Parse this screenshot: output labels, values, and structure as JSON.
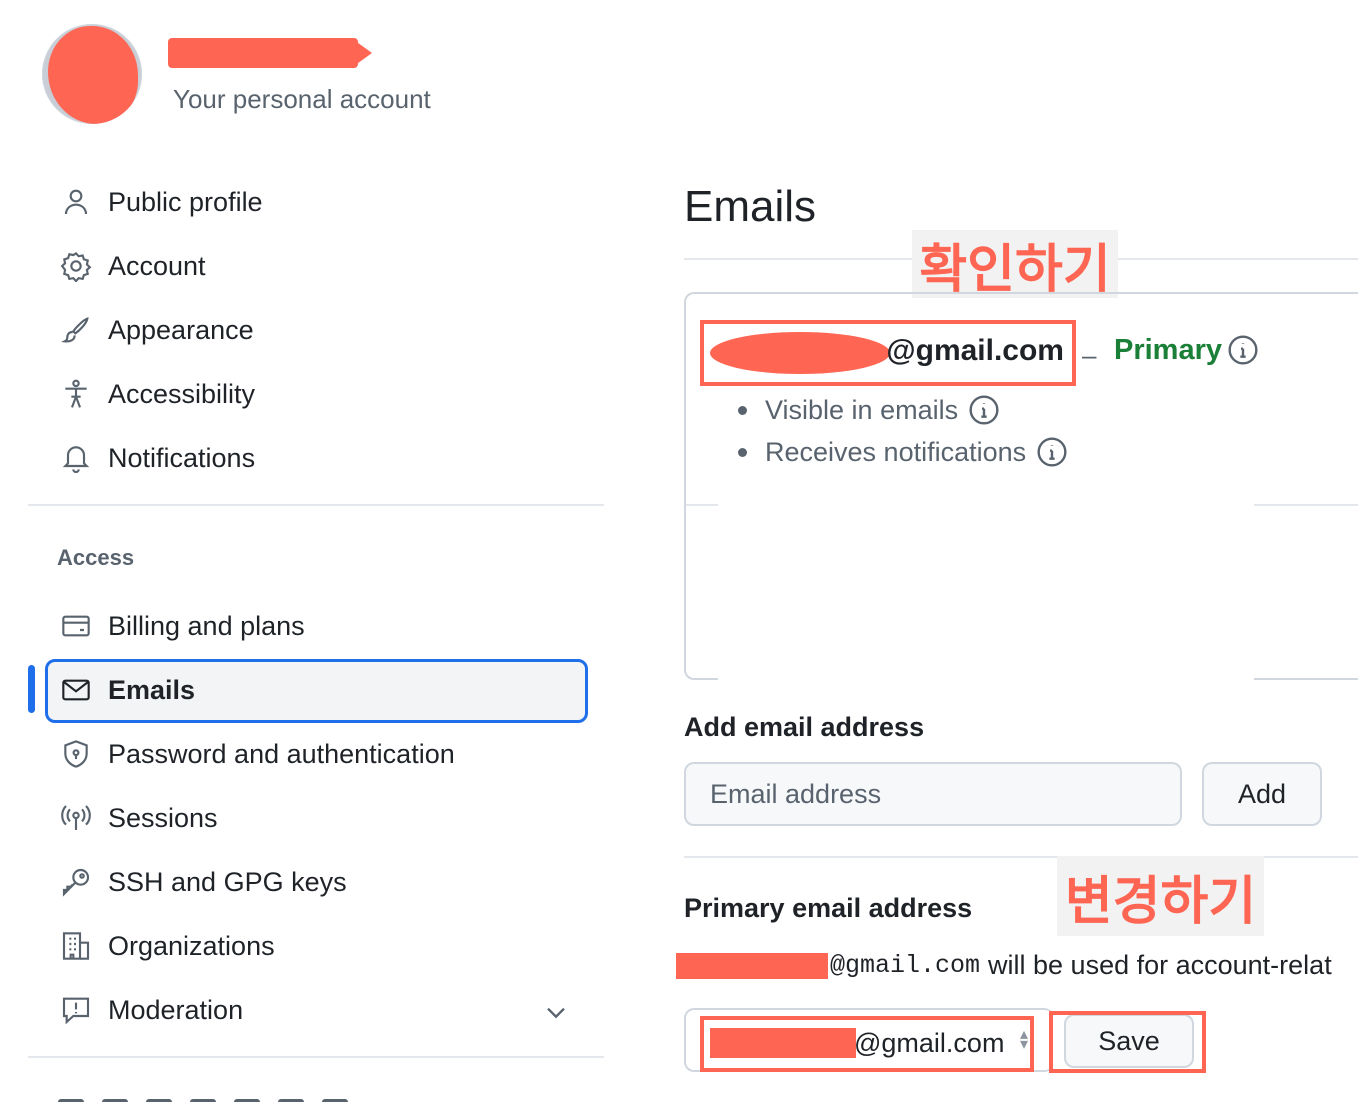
{
  "header": {
    "subtitle": "Your personal account"
  },
  "sidebar": {
    "items": [
      {
        "label": "Public profile",
        "icon": "person-icon"
      },
      {
        "label": "Account",
        "icon": "gear-icon"
      },
      {
        "label": "Appearance",
        "icon": "paintbrush-icon"
      },
      {
        "label": "Accessibility",
        "icon": "accessibility-icon"
      },
      {
        "label": "Notifications",
        "icon": "bell-icon"
      }
    ],
    "access_heading": "Access",
    "access_items": [
      {
        "label": "Billing and plans",
        "icon": "credit-card-icon"
      },
      {
        "label": "Emails",
        "icon": "mail-icon",
        "active": true
      },
      {
        "label": "Password and authentication",
        "icon": "shield-lock-icon"
      },
      {
        "label": "Sessions",
        "icon": "broadcast-icon"
      },
      {
        "label": "SSH and GPG keys",
        "icon": "key-icon"
      },
      {
        "label": "Organizations",
        "icon": "organization-icon"
      },
      {
        "label": "Moderation",
        "icon": "report-icon"
      }
    ]
  },
  "main": {
    "title": "Emails",
    "annotation_check": "확인하기",
    "annotation_change": "변경하기",
    "primary_email": {
      "address_suffix": "@gmail.com",
      "separator": "–",
      "badge": "Primary",
      "bullets": [
        "Visible in emails",
        "Receives notifications"
      ]
    },
    "add_email": {
      "heading": "Add email address",
      "placeholder": "Email address",
      "button": "Add"
    },
    "primary_section": {
      "heading": "Primary email address",
      "sentence_mono": "@gmail.com",
      "sentence_rest": "will be used for account-relat",
      "select_value": "@gmail.com",
      "save_button": "Save"
    }
  },
  "colors": {
    "accent": "#1f6feb",
    "success": "#1a7f37",
    "annotation": "#fe6553",
    "muted": "#59636e",
    "border": "#d0d7de"
  }
}
